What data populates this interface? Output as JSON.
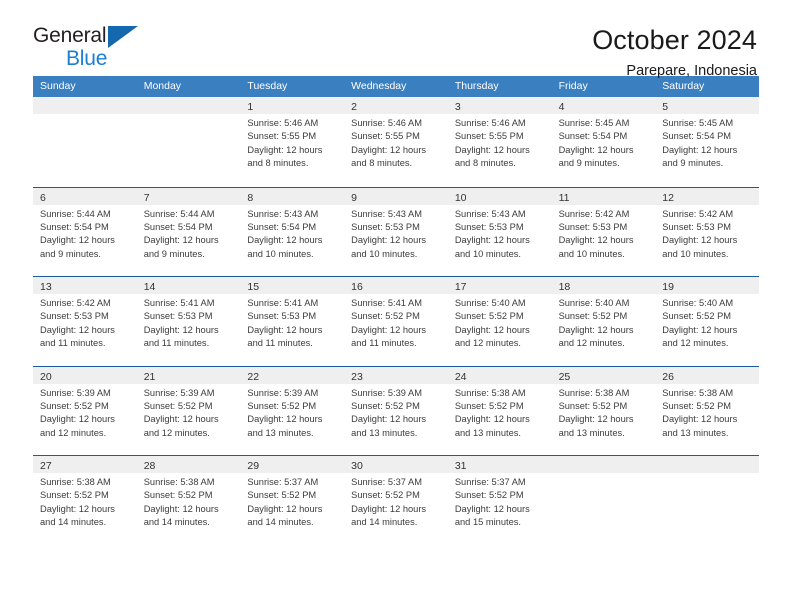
{
  "brand": {
    "name_top": "General",
    "name_bottom": "Blue",
    "accent_color": "#1468ad",
    "text_color": "#231f20"
  },
  "header": {
    "title": "October 2024",
    "subtitle": "Parepare, Indonesia"
  },
  "calendar": {
    "header_bg": "#3a7fc0",
    "row_border_color": "#1b5c9e",
    "daynum_band_color": "#efefef",
    "weekdays": [
      "Sunday",
      "Monday",
      "Tuesday",
      "Wednesday",
      "Thursday",
      "Friday",
      "Saturday"
    ],
    "weeks": [
      [
        {
          "day": "",
          "sunrise": "",
          "sunset": "",
          "daylight": "",
          "empty": true
        },
        {
          "day": "",
          "sunrise": "",
          "sunset": "",
          "daylight": "",
          "empty": true
        },
        {
          "day": "1",
          "sunrise": "Sunrise: 5:46 AM",
          "sunset": "Sunset: 5:55 PM",
          "daylight": "Daylight: 12 hours and 8 minutes."
        },
        {
          "day": "2",
          "sunrise": "Sunrise: 5:46 AM",
          "sunset": "Sunset: 5:55 PM",
          "daylight": "Daylight: 12 hours and 8 minutes."
        },
        {
          "day": "3",
          "sunrise": "Sunrise: 5:46 AM",
          "sunset": "Sunset: 5:55 PM",
          "daylight": "Daylight: 12 hours and 8 minutes."
        },
        {
          "day": "4",
          "sunrise": "Sunrise: 5:45 AM",
          "sunset": "Sunset: 5:54 PM",
          "daylight": "Daylight: 12 hours and 9 minutes."
        },
        {
          "day": "5",
          "sunrise": "Sunrise: 5:45 AM",
          "sunset": "Sunset: 5:54 PM",
          "daylight": "Daylight: 12 hours and 9 minutes."
        }
      ],
      [
        {
          "day": "6",
          "sunrise": "Sunrise: 5:44 AM",
          "sunset": "Sunset: 5:54 PM",
          "daylight": "Daylight: 12 hours and 9 minutes."
        },
        {
          "day": "7",
          "sunrise": "Sunrise: 5:44 AM",
          "sunset": "Sunset: 5:54 PM",
          "daylight": "Daylight: 12 hours and 9 minutes."
        },
        {
          "day": "8",
          "sunrise": "Sunrise: 5:43 AM",
          "sunset": "Sunset: 5:54 PM",
          "daylight": "Daylight: 12 hours and 10 minutes."
        },
        {
          "day": "9",
          "sunrise": "Sunrise: 5:43 AM",
          "sunset": "Sunset: 5:53 PM",
          "daylight": "Daylight: 12 hours and 10 minutes."
        },
        {
          "day": "10",
          "sunrise": "Sunrise: 5:43 AM",
          "sunset": "Sunset: 5:53 PM",
          "daylight": "Daylight: 12 hours and 10 minutes."
        },
        {
          "day": "11",
          "sunrise": "Sunrise: 5:42 AM",
          "sunset": "Sunset: 5:53 PM",
          "daylight": "Daylight: 12 hours and 10 minutes."
        },
        {
          "day": "12",
          "sunrise": "Sunrise: 5:42 AM",
          "sunset": "Sunset: 5:53 PM",
          "daylight": "Daylight: 12 hours and 10 minutes."
        }
      ],
      [
        {
          "day": "13",
          "sunrise": "Sunrise: 5:42 AM",
          "sunset": "Sunset: 5:53 PM",
          "daylight": "Daylight: 12 hours and 11 minutes."
        },
        {
          "day": "14",
          "sunrise": "Sunrise: 5:41 AM",
          "sunset": "Sunset: 5:53 PM",
          "daylight": "Daylight: 12 hours and 11 minutes."
        },
        {
          "day": "15",
          "sunrise": "Sunrise: 5:41 AM",
          "sunset": "Sunset: 5:53 PM",
          "daylight": "Daylight: 12 hours and 11 minutes."
        },
        {
          "day": "16",
          "sunrise": "Sunrise: 5:41 AM",
          "sunset": "Sunset: 5:52 PM",
          "daylight": "Daylight: 12 hours and 11 minutes."
        },
        {
          "day": "17",
          "sunrise": "Sunrise: 5:40 AM",
          "sunset": "Sunset: 5:52 PM",
          "daylight": "Daylight: 12 hours and 12 minutes."
        },
        {
          "day": "18",
          "sunrise": "Sunrise: 5:40 AM",
          "sunset": "Sunset: 5:52 PM",
          "daylight": "Daylight: 12 hours and 12 minutes."
        },
        {
          "day": "19",
          "sunrise": "Sunrise: 5:40 AM",
          "sunset": "Sunset: 5:52 PM",
          "daylight": "Daylight: 12 hours and 12 minutes."
        }
      ],
      [
        {
          "day": "20",
          "sunrise": "Sunrise: 5:39 AM",
          "sunset": "Sunset: 5:52 PM",
          "daylight": "Daylight: 12 hours and 12 minutes."
        },
        {
          "day": "21",
          "sunrise": "Sunrise: 5:39 AM",
          "sunset": "Sunset: 5:52 PM",
          "daylight": "Daylight: 12 hours and 12 minutes."
        },
        {
          "day": "22",
          "sunrise": "Sunrise: 5:39 AM",
          "sunset": "Sunset: 5:52 PM",
          "daylight": "Daylight: 12 hours and 13 minutes."
        },
        {
          "day": "23",
          "sunrise": "Sunrise: 5:39 AM",
          "sunset": "Sunset: 5:52 PM",
          "daylight": "Daylight: 12 hours and 13 minutes."
        },
        {
          "day": "24",
          "sunrise": "Sunrise: 5:38 AM",
          "sunset": "Sunset: 5:52 PM",
          "daylight": "Daylight: 12 hours and 13 minutes."
        },
        {
          "day": "25",
          "sunrise": "Sunrise: 5:38 AM",
          "sunset": "Sunset: 5:52 PM",
          "daylight": "Daylight: 12 hours and 13 minutes."
        },
        {
          "day": "26",
          "sunrise": "Sunrise: 5:38 AM",
          "sunset": "Sunset: 5:52 PM",
          "daylight": "Daylight: 12 hours and 13 minutes."
        }
      ],
      [
        {
          "day": "27",
          "sunrise": "Sunrise: 5:38 AM",
          "sunset": "Sunset: 5:52 PM",
          "daylight": "Daylight: 12 hours and 14 minutes."
        },
        {
          "day": "28",
          "sunrise": "Sunrise: 5:38 AM",
          "sunset": "Sunset: 5:52 PM",
          "daylight": "Daylight: 12 hours and 14 minutes."
        },
        {
          "day": "29",
          "sunrise": "Sunrise: 5:37 AM",
          "sunset": "Sunset: 5:52 PM",
          "daylight": "Daylight: 12 hours and 14 minutes."
        },
        {
          "day": "30",
          "sunrise": "Sunrise: 5:37 AM",
          "sunset": "Sunset: 5:52 PM",
          "daylight": "Daylight: 12 hours and 14 minutes."
        },
        {
          "day": "31",
          "sunrise": "Sunrise: 5:37 AM",
          "sunset": "Sunset: 5:52 PM",
          "daylight": "Daylight: 12 hours and 15 minutes."
        },
        {
          "day": "",
          "sunrise": "",
          "sunset": "",
          "daylight": "",
          "empty": true
        },
        {
          "day": "",
          "sunrise": "",
          "sunset": "",
          "daylight": "",
          "empty": true
        }
      ]
    ]
  }
}
